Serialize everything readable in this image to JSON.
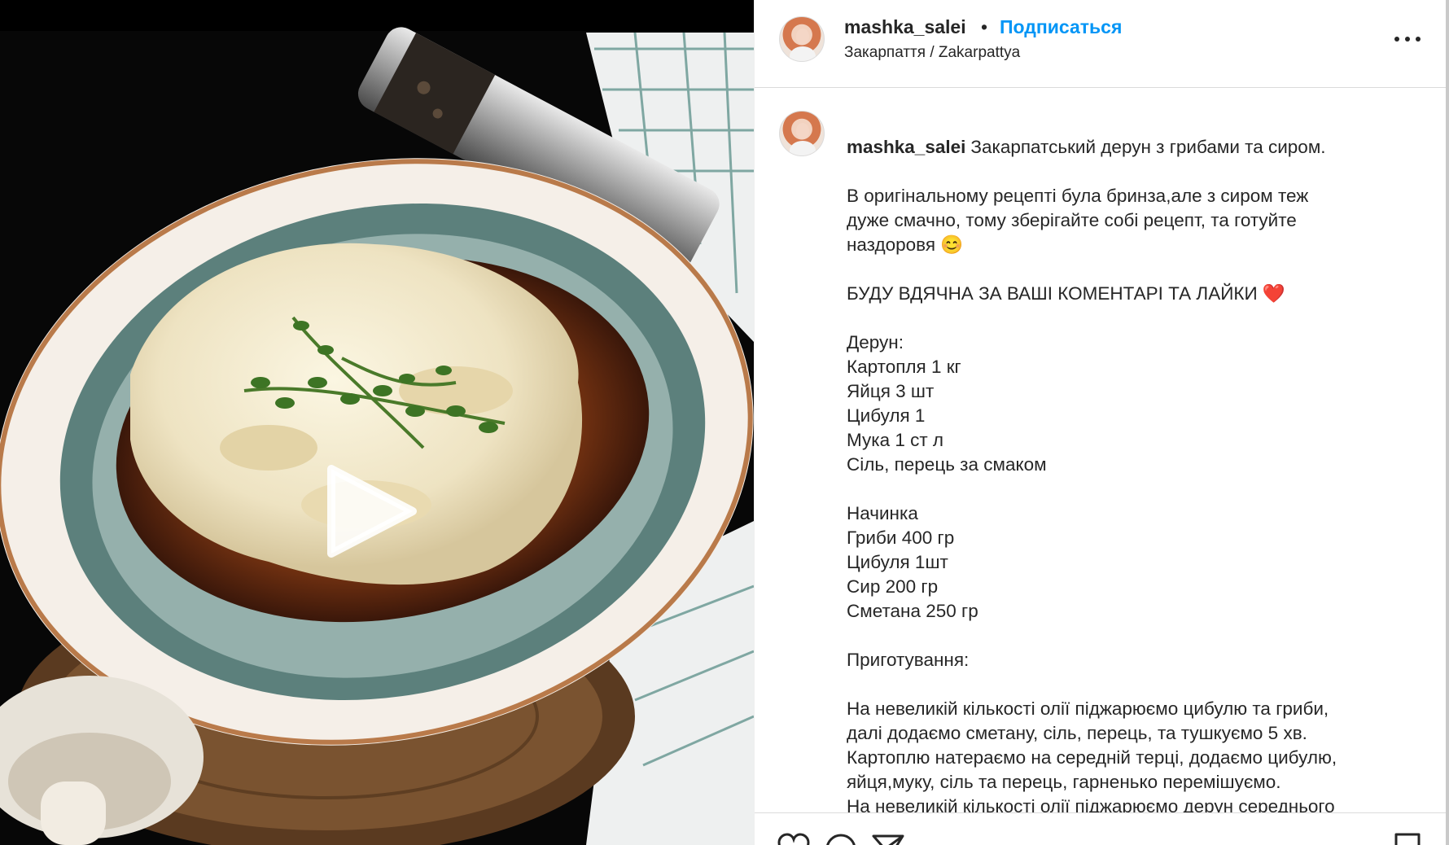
{
  "post": {
    "username": "mashka_salei",
    "separator": "•",
    "follow_label": "Подписаться",
    "location": "Закарпаття / Zakarpattya"
  },
  "caption": {
    "username": "mashka_salei",
    "first_line": "Закарпатський дерун з грибами та сиром.",
    "paragraphs": [
      "В оригінальному рецепті була бринза,але з сиром теж\nдуже смачно, тому зберігайте собі рецепт, та готуйте\nназдоровя 😊",
      "БУДУ ВДЯЧНА ЗА ВАШІ КОМЕНТАРІ ТА ЛАЙКИ ❤️",
      "Дерун:\nКартопля 1 кг\nЯйця 3 шт\nЦибуля 1\nМука 1 ст л\nСіль, перець за смаком",
      "Начинка\nГриби 400 гр\nЦибуля 1шт\nСир 200 гр\nСметана 250 гр",
      "Приготування:",
      "На невеликій кількості олії піджарюємо цибулю та гриби,\nдалі додаємо сметану, сіль, перець, та тушкуємо 5 хв.\nКартоплю натераємо на середній терці, додаємо цибулю,\nяйця,муку, сіль та перець, гарненько перемішуємо.\nНа невеликій кількості олії піджарюємо дерун середнього\nрозміру, спочатку з однієї сторони, потім перевертаємо"
    ]
  },
  "icons": {
    "play": "play-icon",
    "more": "more-options-icon",
    "like": "heart-icon",
    "comment": "comment-icon",
    "share": "share-icon",
    "save": "bookmark-icon"
  },
  "colors": {
    "link": "#0095f6",
    "text": "#262626",
    "border": "#dbdbdb"
  }
}
